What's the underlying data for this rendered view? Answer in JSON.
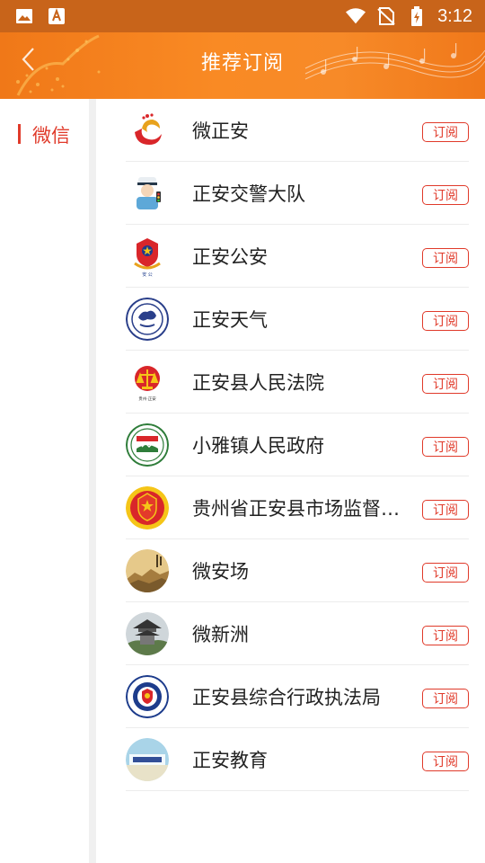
{
  "status_bar": {
    "time": "3:12",
    "left_icons": [
      "image-icon",
      "font-a-icon"
    ],
    "right_icons": [
      "wifi-icon",
      "no-sim-icon",
      "battery-charging-icon"
    ]
  },
  "header": {
    "title": "推荐订阅",
    "back_icon": "chevron-left-icon"
  },
  "sidebar": {
    "items": [
      {
        "label": "微信",
        "selected": true
      }
    ]
  },
  "accounts": [
    {
      "name": "微正安",
      "button": "订阅",
      "icon": "wei-zhengan-logo-icon"
    },
    {
      "name": "正安交警大队",
      "button": "订阅",
      "icon": "traffic-police-logo-icon"
    },
    {
      "name": "正安公安",
      "button": "订阅",
      "icon": "police-emblem-icon"
    },
    {
      "name": "正安天气",
      "button": "订阅",
      "icon": "weather-bureau-logo-icon"
    },
    {
      "name": "正安县人民法院",
      "button": "订阅",
      "icon": "court-emblem-icon"
    },
    {
      "name": "小雅镇人民政府",
      "button": "订阅",
      "icon": "town-government-logo-icon"
    },
    {
      "name": "贵州省正安县市场监督…",
      "button": "订阅",
      "icon": "market-supervision-emblem-icon"
    },
    {
      "name": "微安场",
      "button": "订阅",
      "icon": "anchang-landscape-icon"
    },
    {
      "name": "微新洲",
      "button": "订阅",
      "icon": "pavilion-photo-icon"
    },
    {
      "name": "正安县综合行政执法局",
      "button": "订阅",
      "icon": "law-enforcement-badge-icon"
    },
    {
      "name": "正安教育",
      "button": "订阅",
      "icon": "education-logo-icon"
    }
  ],
  "colors": {
    "status_bar": "#c8641a",
    "header": "#f98a24",
    "accent_red": "#e03a2a"
  }
}
